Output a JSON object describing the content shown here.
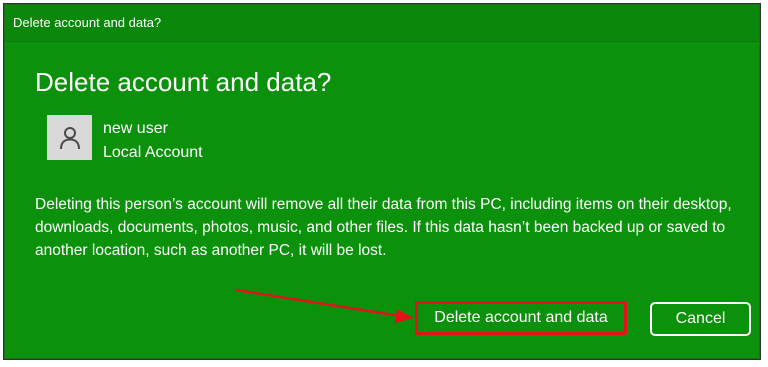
{
  "window": {
    "title": "Delete account and data?"
  },
  "dialog": {
    "heading": "Delete account and data?",
    "account": {
      "name": "new user",
      "type": "Local Account",
      "icon": "person-icon"
    },
    "warning": "Deleting this person’s account will remove all their data from this PC, including items on their desktop, downloads, documents, photos, music, and other files. If this data hasn’t been backed up or saved to another location, such as another PC, it will be lost.",
    "buttons": {
      "delete_label": "Delete account and data",
      "cancel_label": "Cancel"
    }
  },
  "annotation": {
    "type": "arrow",
    "color": "#e0141a",
    "points_to": "delete-account-button"
  },
  "colors": {
    "background": "#0c910c",
    "highlight": "#e0141a",
    "text": "#ffffff"
  }
}
